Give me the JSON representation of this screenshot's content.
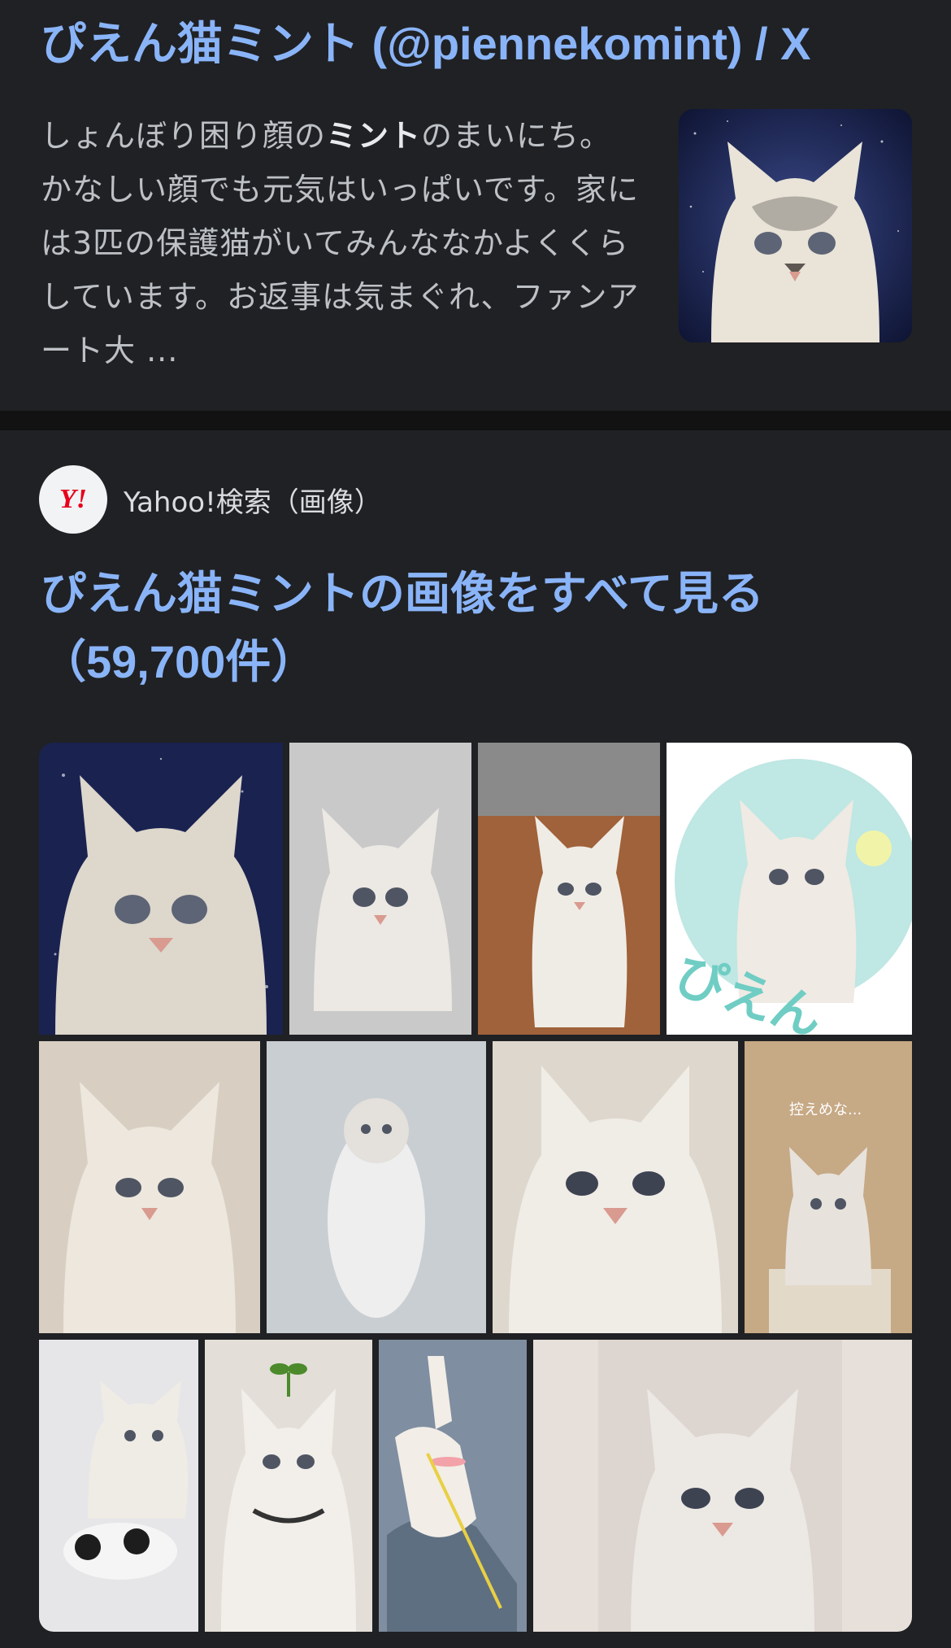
{
  "result": {
    "title": "ぴえん猫ミント (@piennekomint) / X",
    "snippet_prefix": "しょんぼり困り顔の",
    "snippet_bold": "ミント",
    "snippet_suffix": "のまいにち。かなしい顔でも元気はいっぱいです。家には3匹の保護猫がいてみんななかよくくらしています。お返事は気まぐれ、ファンアート大 ...",
    "thumbnail_icon": "cat-photo-icon"
  },
  "image_pack": {
    "source_name": "Yahoo!検索（画像）",
    "favicon_text": "Y!",
    "favicon_color": "#e8001b",
    "title": "ぴえん猫ミントの画像をすべて見る（59,700件）",
    "images": [
      {
        "id": "img-1",
        "bg": "#1a2250",
        "accent": "#d9d4cc"
      },
      {
        "id": "img-2",
        "bg": "#cfcfcf",
        "accent": "#ece9e4"
      },
      {
        "id": "img-3",
        "bg": "#a0623a",
        "accent": "#efece6"
      },
      {
        "id": "img-4",
        "bg": "#ffffff",
        "accent": "#bfe7e3",
        "overlay_text": "ぴえん"
      },
      {
        "id": "img-5",
        "bg": "#d8cfc2",
        "accent": "#ede7dd"
      },
      {
        "id": "img-6",
        "bg": "#c9ced2",
        "accent": "#eeeeee"
      },
      {
        "id": "img-7",
        "bg": "#ded7cd",
        "accent": "#f0ece6"
      },
      {
        "id": "img-8",
        "bg": "#c6a985",
        "accent": "#e7e2dc",
        "overlay_text": "控えめな..."
      },
      {
        "id": "img-9",
        "bg": "#e6e6e8",
        "accent": "#1d1d1d"
      },
      {
        "id": "img-10",
        "bg": "#e3ded7",
        "accent": "#4c8a2c"
      },
      {
        "id": "img-11",
        "bg": "#7f8ea0",
        "accent": "#f2a2a8"
      },
      {
        "id": "img-12",
        "bg": "#e6dfda",
        "accent": "#ddd5cf"
      }
    ]
  }
}
